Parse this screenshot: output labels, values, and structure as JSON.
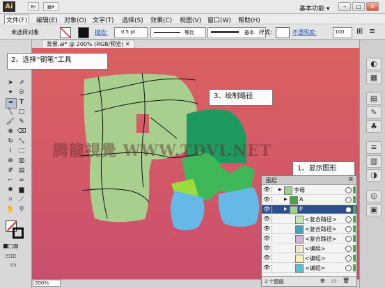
{
  "titlebar": {
    "logo": "Ai",
    "workspace": "基本功能"
  },
  "menus": [
    "文件(F)",
    "编辑(E)",
    "对象(O)",
    "文字(T)",
    "选择(S)",
    "效果(C)",
    "视图(V)",
    "窗口(W)",
    "帮助(H)"
  ],
  "control": {
    "selection_state": "未选择对象",
    "stroke_label": "描边:",
    "stroke_value": "0.5 pt",
    "profile_label": "等比",
    "brush_label": "基本",
    "style_label": "样式:",
    "opacity_label": "不透明度:",
    "opacity_value": "100"
  },
  "document": {
    "tab_title": "背景.ai* @ 200% (RGB/预览)",
    "zoom": "200%"
  },
  "callouts": {
    "step2": "2、选择“钢笔”工具",
    "step3": "3、绘制路径",
    "step1": "1、显示图形"
  },
  "watermark": "腾龍視覺 WWW.TDVI.NET",
  "layers": {
    "title": "图层",
    "footer": "2 个图层",
    "rows": [
      {
        "name": "字母",
        "thumb_color": "#9bd48a",
        "color": "#4ea64e"
      },
      {
        "name": "A",
        "thumb_color": "#48a83f",
        "color": "#4ea64e"
      },
      {
        "name": "P",
        "thumb_color": "#9ad18c",
        "color": "#4ea64e"
      },
      {
        "name": "<复合路径>",
        "thumb_color": "#c7e6b5",
        "color": "#4ea64e"
      },
      {
        "name": "<复合路径>",
        "thumb_color": "#3fa6c4",
        "color": "#4ea64e"
      },
      {
        "name": "<复合路径>",
        "thumb_color": "#d7b3da",
        "color": "#4ea64e"
      },
      {
        "name": "<编组>",
        "thumb_color": "#f1e8c9",
        "color": "#4ea64e"
      },
      {
        "name": "<编组>",
        "thumb_color": "#f3f0b8",
        "color": "#4ea64e"
      },
      {
        "name": "<编组>",
        "thumb_color": "#52c2d8",
        "color": "#4ea64e"
      }
    ]
  },
  "colors": {
    "canvas_top": "#d9605f",
    "letter_p": "#a8cf8e",
    "letter_a_dark": "#1f9a5e",
    "letter_a_mid": "#3fb85a",
    "letter_a_light": "#9bdc3c",
    "letter_a_blue": "#66b9e7",
    "layer_selection": "#2e4f8e"
  }
}
